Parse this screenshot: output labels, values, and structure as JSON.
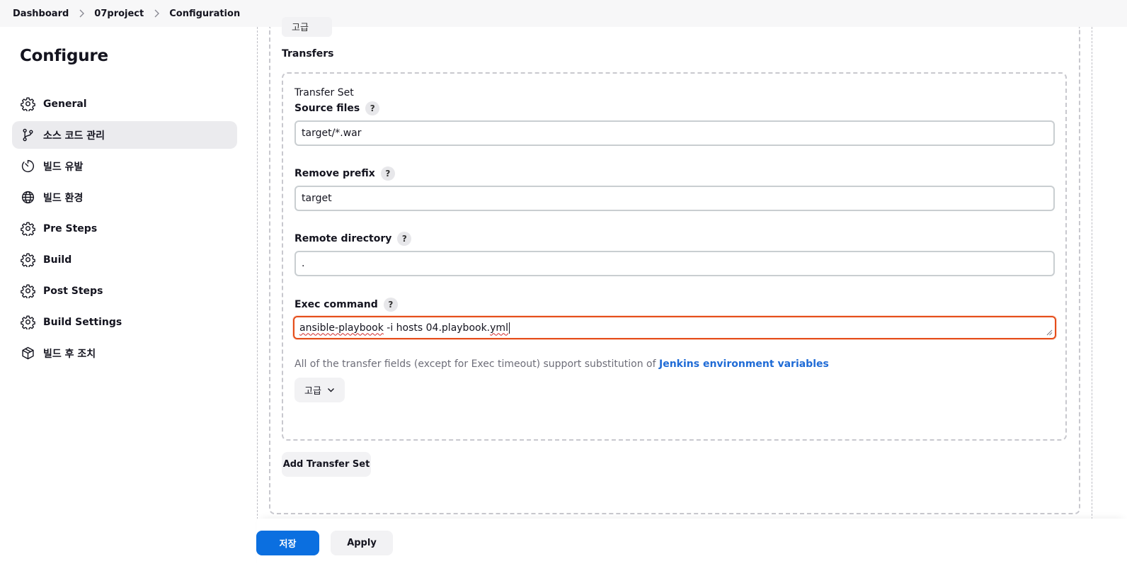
{
  "breadcrumb": {
    "items": [
      "Dashboard",
      "07project",
      "Configuration"
    ]
  },
  "sidebar": {
    "title": "Configure",
    "items": [
      {
        "label": "General",
        "icon": "gear-icon",
        "active": false
      },
      {
        "label": "소스 코드 관리",
        "icon": "git-branch-icon",
        "active": true
      },
      {
        "label": "빌드 유발",
        "icon": "timer-icon",
        "active": false
      },
      {
        "label": "빌드 환경",
        "icon": "globe-icon",
        "active": false
      },
      {
        "label": "Pre Steps",
        "icon": "gear-icon",
        "active": false
      },
      {
        "label": "Build",
        "icon": "gear-icon",
        "active": false
      },
      {
        "label": "Post Steps",
        "icon": "gear-icon",
        "active": false
      },
      {
        "label": "Build Settings",
        "icon": "gear-icon",
        "active": false
      },
      {
        "label": "빌드 후 조치",
        "icon": "package-icon",
        "active": false
      }
    ]
  },
  "main": {
    "clipped_button_label": "고급",
    "transfers_title": "Transfers",
    "transfer_set_title": "Transfer Set",
    "help_label": "?",
    "fields": {
      "source_files": {
        "label": "Source files",
        "value": "target/*.war"
      },
      "remove_prefix": {
        "label": "Remove prefix",
        "value": "target"
      },
      "remote_directory": {
        "label": "Remote directory",
        "value": "."
      },
      "exec_command": {
        "label": "Exec command",
        "value_word1": "ansible-playbook",
        "value_middle": " -i hosts 04.playbook.",
        "value_word2": "yml"
      }
    },
    "hint_text": "All of the transfer fields (except for Exec timeout) support substitution of ",
    "hint_link": "Jenkins environment variables",
    "advanced_label": "고급",
    "add_transfer_set_label": "Add Transfer Set"
  },
  "footer": {
    "save_label": "저장",
    "apply_label": "Apply"
  },
  "colors": {
    "primary": "#0b6fe0",
    "error_border": "#e54d1a",
    "link": "#1f6bd6",
    "active_bg": "#ebebee"
  }
}
